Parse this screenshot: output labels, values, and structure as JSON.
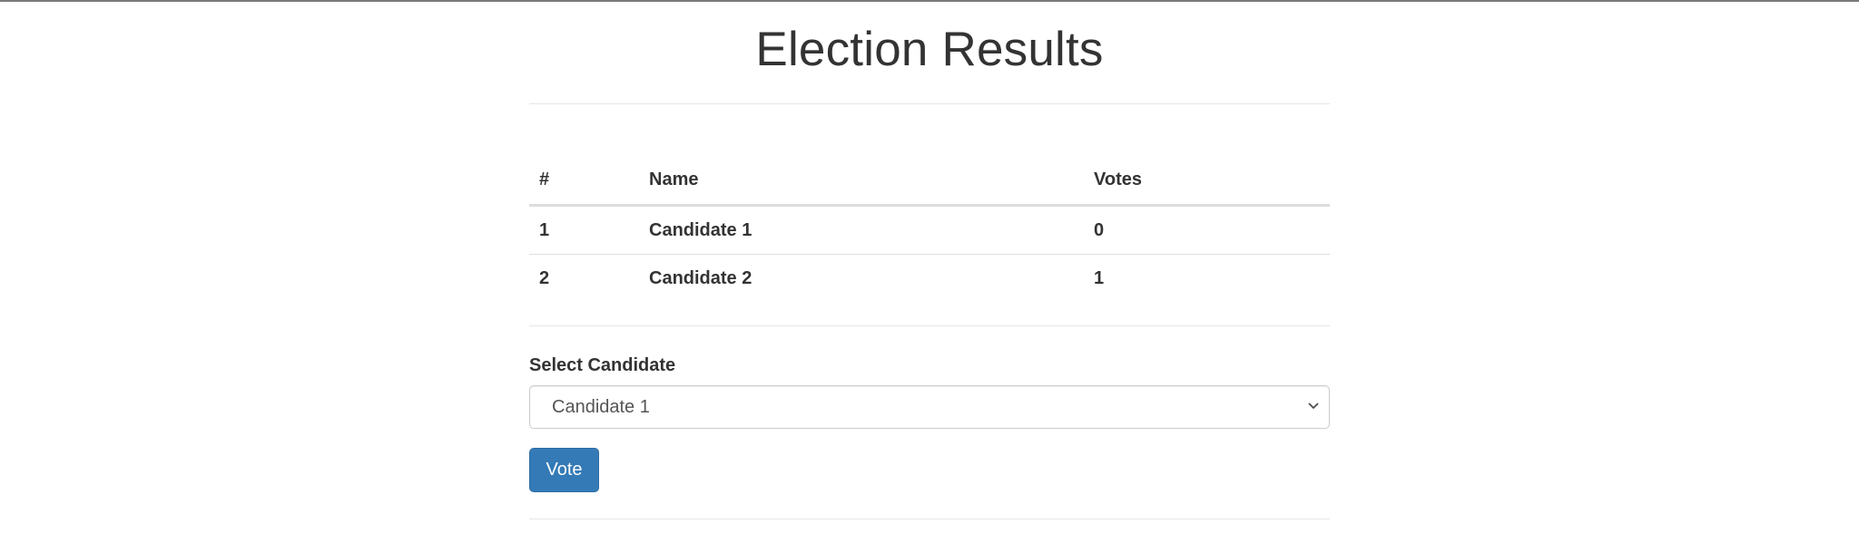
{
  "page": {
    "title": "Election Results"
  },
  "results_table": {
    "headers": [
      "#",
      "Name",
      "Votes"
    ],
    "rows": [
      {
        "num": "1",
        "name": "Candidate 1",
        "votes": "0"
      },
      {
        "num": "2",
        "name": "Candidate 2",
        "votes": "1"
      }
    ]
  },
  "vote_form": {
    "select_label": "Select Candidate",
    "selected_value": "Candidate 1",
    "button_label": "Vote"
  },
  "colors": {
    "button_primary": "#337ab7",
    "text": "#333333",
    "divider": "#e6e6e6"
  },
  "icons": {
    "select_arrow": "chevron-down-icon"
  }
}
